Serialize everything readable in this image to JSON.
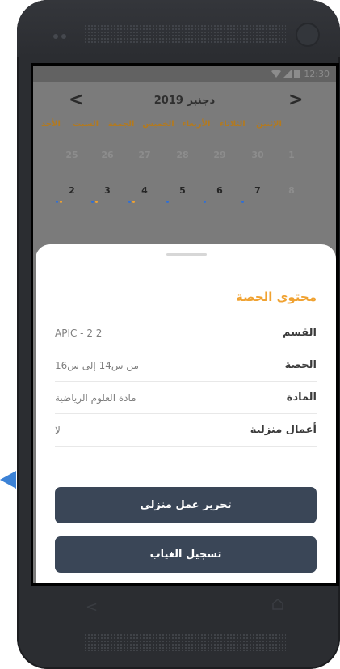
{
  "statusbar": {
    "time": "12:30"
  },
  "calendar": {
    "month_title": "دجنبر 2019",
    "prev_label": "<",
    "next_label": ">",
    "weekdays": [
      "الأحد",
      "السبت",
      "الجمعة",
      "الخميس",
      "الأربعاء",
      "الثلاثاء",
      "الإثنين"
    ],
    "week1": [
      "1",
      "30",
      "29",
      "28",
      "27",
      "26",
      "25"
    ],
    "week2": [
      "8",
      "7",
      "6",
      "5",
      "4",
      "3",
      "2"
    ]
  },
  "sheet": {
    "title": "محتوى الحصة",
    "rows": [
      {
        "label": "القسم",
        "value": "2 APIC - 2"
      },
      {
        "label": "الحصة",
        "value": "من س14 إلى س16"
      },
      {
        "label": "المادة",
        "value": "مادة العلوم الرياضية"
      },
      {
        "label": "أعمال منزلية",
        "value": "لا"
      }
    ],
    "btn_edit_homework": "تحرير عمل منزلي",
    "btn_record_absence": "تسجيل الغياب"
  },
  "colors": {
    "accent": "#f0a231",
    "button": "#3a4657",
    "weekday": "#b37a1f",
    "dot_blue": "#2f6fd6",
    "dot_orange": "#f0a231"
  }
}
